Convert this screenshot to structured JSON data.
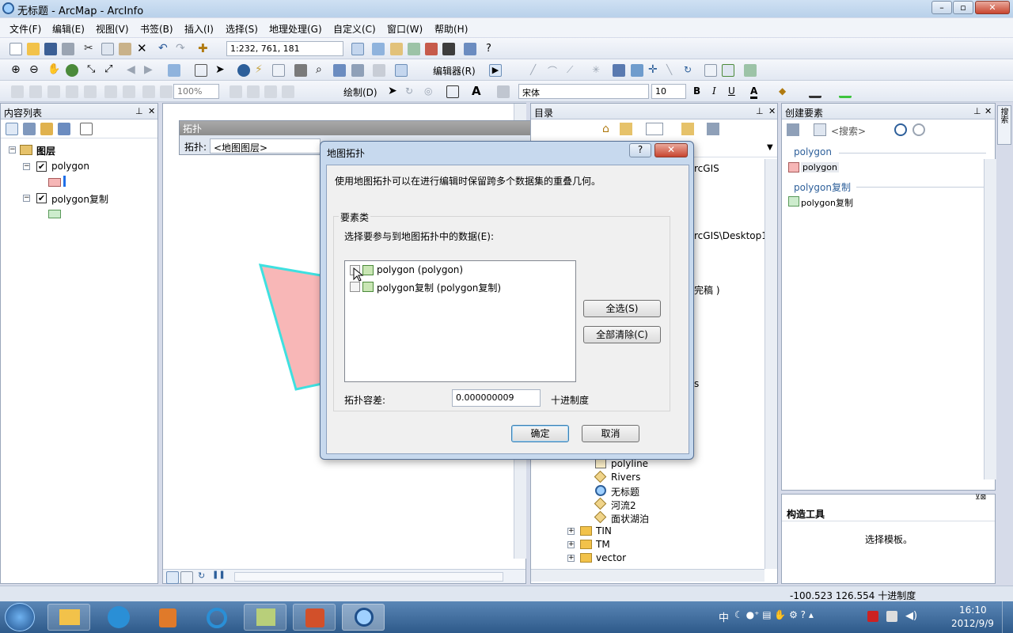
{
  "window": {
    "title": "无标题 - ArcMap - ArcInfo"
  },
  "menu": [
    "文件(F)",
    "编辑(E)",
    "视图(V)",
    "书签(B)",
    "插入(I)",
    "选择(S)",
    "地理处理(G)",
    "自定义(C)",
    "窗口(W)",
    "帮助(H)"
  ],
  "toolbar": {
    "scale": "1:232, 761, 181",
    "zoom": "100%",
    "editor": "编辑器(R)",
    "draw": "绘制(D)",
    "font": "宋体",
    "font_size": "10",
    "bold": "B",
    "italic": "I",
    "underline": "U",
    "font_color": "A"
  },
  "toc": {
    "title": "内容列表",
    "root": "图层",
    "layers": [
      {
        "name": "polygon",
        "checked": true,
        "swatch": "#f6b6b6"
      },
      {
        "name": "polygon复制",
        "checked": true,
        "swatch": "#cdeccd"
      }
    ]
  },
  "topology_toolbar": {
    "title": "拓扑",
    "label": "拓扑:",
    "value": "<地图图层>"
  },
  "catalog": {
    "title": "目录",
    "partial_texts": [
      "rcGIS",
      "rcGIS\\Desktop1",
      "完稿 )",
      "s"
    ],
    "items": [
      {
        "name": "polyline",
        "icon": "line-feature-icon"
      },
      {
        "name": "Rivers",
        "icon": "layer-diamond-icon"
      },
      {
        "name": "无标题",
        "icon": "map-document-icon"
      },
      {
        "name": "河流2",
        "icon": "layer-diamond-icon"
      },
      {
        "name": "面状湖泊",
        "icon": "layer-diamond-icon"
      }
    ],
    "folders": [
      "TIN",
      "TM",
      "vector"
    ]
  },
  "create_features": {
    "title": "创建要素",
    "search_placeholder": "<搜索>",
    "groups": [
      {
        "header": "polygon",
        "item": "polygon",
        "swatch": "#f6b6b6"
      },
      {
        "header": "polygon复制",
        "item": "polygon复制",
        "swatch": "#cdeccd"
      }
    ],
    "construct_title": "构造工具",
    "construct_hint": "选择模板。"
  },
  "dialog": {
    "title": "地图拓扑",
    "help": "?",
    "description": "使用地图拓扑可以在进行编辑时保留跨多个数据集的重叠几何。",
    "group_label": "要素类",
    "instruction": "选择要参与到地图拓扑中的数据(E):",
    "feature_classes": [
      {
        "label": "polygon (polygon)",
        "checked": false
      },
      {
        "label": "polygon复制 (polygon复制)",
        "checked": false
      }
    ],
    "select_all": "全选(S)",
    "clear_all": "全部清除(C)",
    "tolerance_label": "拓扑容差:",
    "tolerance_value": "0.000000009",
    "tolerance_unit": "十进制度",
    "ok": "确定",
    "cancel": "取消"
  },
  "status": {
    "coords": "-100.523  126.554 十进制度"
  },
  "taskbar": {
    "time": "16:10",
    "date": "2012/9/9",
    "ime": "中"
  },
  "colors": {
    "polygon_fill": "#f8b7b7",
    "polygon_outline": "#3fe0e0",
    "swatch_pink": "#f6b6b6",
    "swatch_green": "#cdeccd"
  }
}
